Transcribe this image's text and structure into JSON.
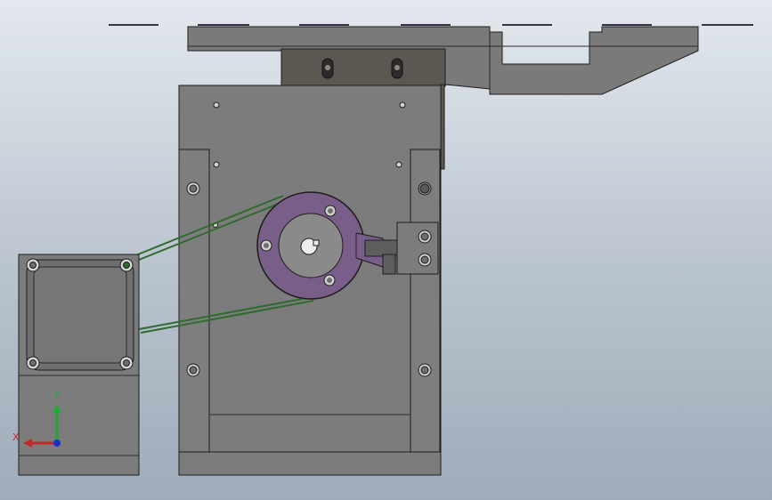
{
  "viewport": {
    "background_top": "#e3e8ee",
    "background_bottom": "#9eabb9"
  },
  "colors": {
    "part": "#7b7b7b",
    "part_dark": "#5f5c57",
    "edge": "#1d1d1d",
    "pulley": "#7a5e8a",
    "belt": "#2f6b2f",
    "guide": "#8a8a8a"
  },
  "triad": {
    "x_label": "X",
    "y_label": "Y",
    "x_color": "#c0282a",
    "y_color": "#23a63a",
    "z_color": "#1e2cc8"
  }
}
